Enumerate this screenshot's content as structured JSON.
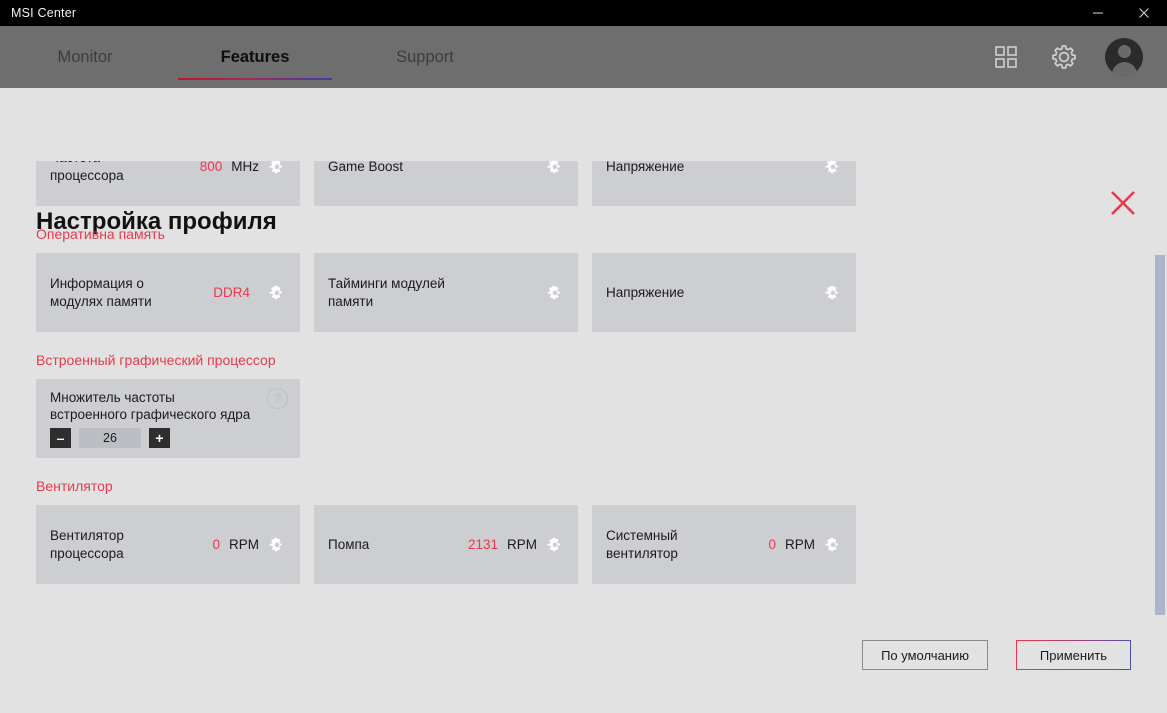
{
  "window": {
    "app_title": "MSI Center",
    "minimize_label": "Minimize",
    "close_label": "Close"
  },
  "nav": {
    "tabs": [
      {
        "label": "Monitor",
        "active": false
      },
      {
        "label": "Features",
        "active": true
      },
      {
        "label": "Support",
        "active": false
      }
    ],
    "grid_icon": "grid-icon",
    "settings_icon": "gear-icon",
    "avatar": "user-avatar"
  },
  "modal": {
    "title": "Настройка профиля",
    "close_icon": "close-icon"
  },
  "sections": [
    {
      "title": "",
      "clipped": true,
      "cards": [
        {
          "label": "Частота процессора",
          "value": "800",
          "unit": "MHz",
          "gear": true
        },
        {
          "label": "Game Boost",
          "value": "",
          "unit": "",
          "gear": true
        },
        {
          "label": "Напряжение",
          "value": "",
          "unit": "",
          "gear": true
        }
      ]
    },
    {
      "title": "Оперативна память",
      "cards": [
        {
          "label": "Информация о модулях памяти",
          "value": "DDR4",
          "unit": "",
          "gear": true
        },
        {
          "label": "Тайминги модулей памяти",
          "value": "",
          "unit": "",
          "gear": true
        },
        {
          "label": "Напряжение",
          "value": "",
          "unit": "",
          "gear": true
        }
      ]
    },
    {
      "title": "Встроенный графический процессор",
      "igpu": {
        "label": "Множитель частоты встроенного графического ядра",
        "help_icon": "help-icon",
        "help_label": "?",
        "minus_label": "–",
        "plus_label": "+",
        "value": "26"
      }
    },
    {
      "title": "Вентилятор",
      "cards": [
        {
          "label": "Вентилятор процессора",
          "value": "0",
          "unit": "RPM",
          "gear": true
        },
        {
          "label": "Помпа",
          "value": "2131",
          "unit": "RPM",
          "gear": true
        },
        {
          "label": "Системный вентилятор",
          "value": "0",
          "unit": "RPM",
          "gear": true
        }
      ]
    }
  ],
  "footer": {
    "default_label": "По умолчанию",
    "apply_label": "Применить"
  },
  "colors": {
    "accent_red": "#e8394e",
    "accent_blue": "#4a4fb0",
    "card_bg": "#cdced2",
    "page_bg": "#e2e2e2",
    "nav_bg": "#6e6e6e",
    "titlebar_bg": "#000000",
    "scrollbar_thumb": "#aeb4c7"
  }
}
